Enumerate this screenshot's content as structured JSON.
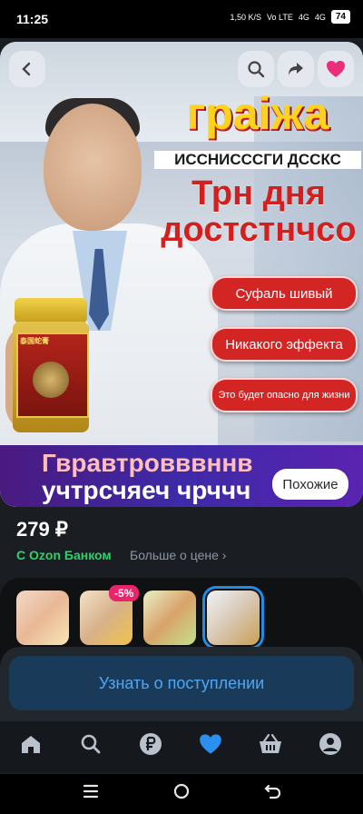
{
  "status": {
    "time": "11:25",
    "net_speed": "1,50 K/S",
    "volte": "Vo LTE",
    "signal1": "4G",
    "signal2": "4G",
    "battery": "74"
  },
  "hero": {
    "title": "граіжа",
    "subtitle": "ИССНИСССГИ ДССКС",
    "days_line1": "Трн дня",
    "days_line2": "достстнчсо",
    "pill1": "Суфаль шивый",
    "pill2": "Никакого эффекта",
    "pill3": "Это будет опасно для жизни",
    "band_line1": "Гвравтровввннв",
    "band_line2": "учтрсчяеч чрччч",
    "jar_text": "泰国蛇膏"
  },
  "controls": {
    "back_icon": "chevron-left-icon",
    "search_icon": "search-icon",
    "share_icon": "share-icon",
    "favorite_icon": "heart-icon",
    "similar_label": "Похожие"
  },
  "pricing": {
    "price": "279 ₽",
    "ozon_bank": "С Ozon Банком",
    "more_price": "Больше о цене ›"
  },
  "thumbnails": {
    "discount_badge": "-5%"
  },
  "notify": {
    "label": "Узнать о поступлении"
  },
  "tabs": [
    "home-icon",
    "search-icon",
    "ruble-icon",
    "heart-icon",
    "basket-icon",
    "profile-icon"
  ],
  "colors": {
    "accent_blue": "#4ea7f5",
    "ozon_green": "#2fd16a",
    "favorite_pink": "#e8246b"
  }
}
